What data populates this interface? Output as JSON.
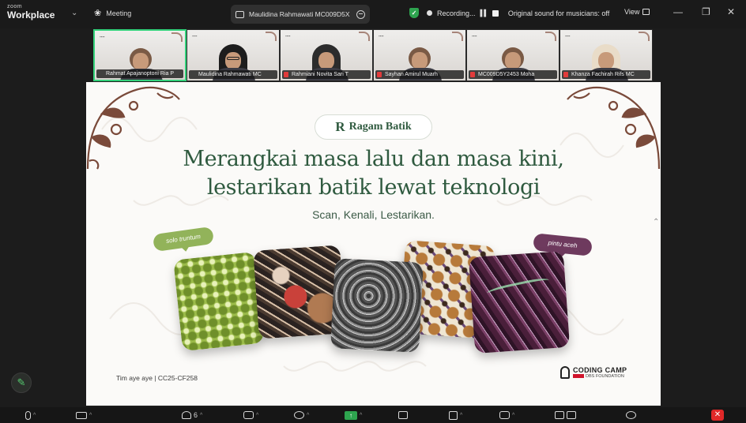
{
  "app": {
    "brand_line1": "zoom",
    "brand_line2": "Workplace",
    "meeting_label": "Meeting",
    "sharing_label": "Maulidina Rahmawati MC009D5X",
    "recording_label": "Recording...",
    "audio_label": "Original sound for musicians: off",
    "view_label": "View"
  },
  "participants": [
    {
      "name": "Rahmat Apajanoptoni Ria P",
      "active": true,
      "muted": false,
      "hijab": false,
      "glasses": false
    },
    {
      "name": "Maulidina Rahmawati MC",
      "active": false,
      "muted": false,
      "hijab": true,
      "glasses": true
    },
    {
      "name": "Rahmiani Novita Sari T",
      "active": false,
      "muted": true,
      "hijab": true,
      "glasses": false
    },
    {
      "name": "Sayhan Amirul Muarh",
      "active": false,
      "muted": true,
      "hijab": false,
      "glasses": false
    },
    {
      "name": "MC009D5Y2453 Moha",
      "active": false,
      "muted": true,
      "hijab": false,
      "glasses": false
    },
    {
      "name": "Khanza Fachirah Rifs MC",
      "active": false,
      "muted": true,
      "hijab": true,
      "glasses": false
    }
  ],
  "slide": {
    "logo_text": "Ragam Batik",
    "logo_mark": "R",
    "headline_line1": "Merangkai masa lalu dan masa kini,",
    "headline_line2": "lestarikan batik lewat teknologi",
    "subheadline": "Scan, Kenali, Lestarikan.",
    "tag_left": "solo truntum",
    "tag_right": "pintu aceh",
    "footer_left": "Tim aye aye | CC25-CF258",
    "sponsor_line1": "CODING CAMP",
    "sponsor_line2": "DBS FOUNDATION"
  },
  "toolbar": {
    "participants_count": "6"
  },
  "colors": {
    "accent_green": "#2f5a3f",
    "tag_green": "#92b35a",
    "tag_purple": "#6e3a5e",
    "active_border": "#33d17a",
    "end_red": "#e02828"
  }
}
